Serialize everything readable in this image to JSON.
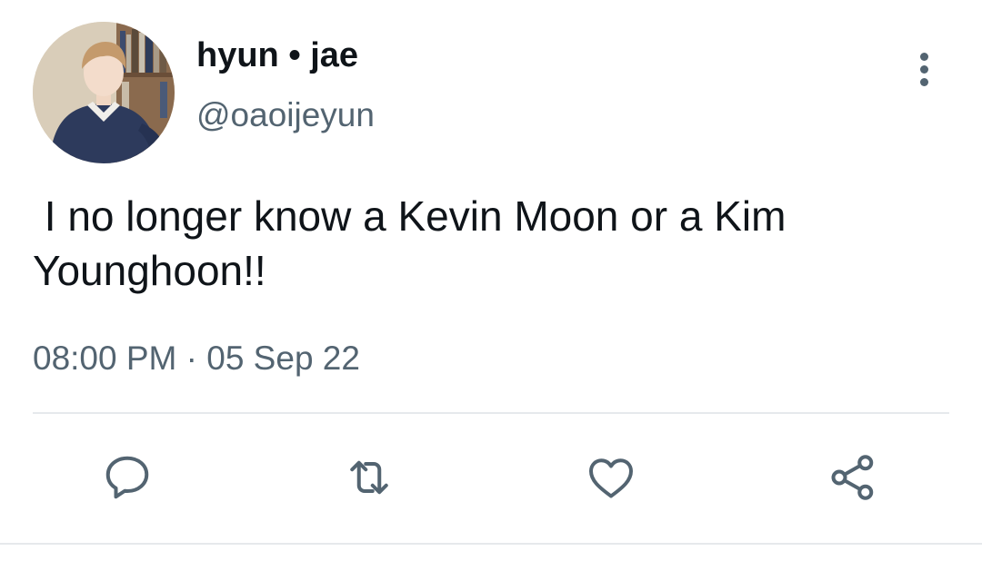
{
  "author": {
    "display_name": "hyun • jae",
    "handle": "@oaoijeyun",
    "avatar_icon": "profile-photo"
  },
  "tweet": {
    "text": " I no longer know a Kevin Moon or a Kim Younghoon!!",
    "timestamp": "08:00 PM · 05 Sep 22"
  },
  "actions": {
    "reply_icon": "speech-bubble-icon",
    "retweet_icon": "retweet-icon",
    "like_icon": "heart-icon",
    "share_icon": "share-icon",
    "more_icon": "vertical-ellipsis-icon"
  },
  "colors": {
    "primary_text": "#0f1419",
    "secondary_text": "#536471",
    "divider": "#e6e9ec"
  }
}
